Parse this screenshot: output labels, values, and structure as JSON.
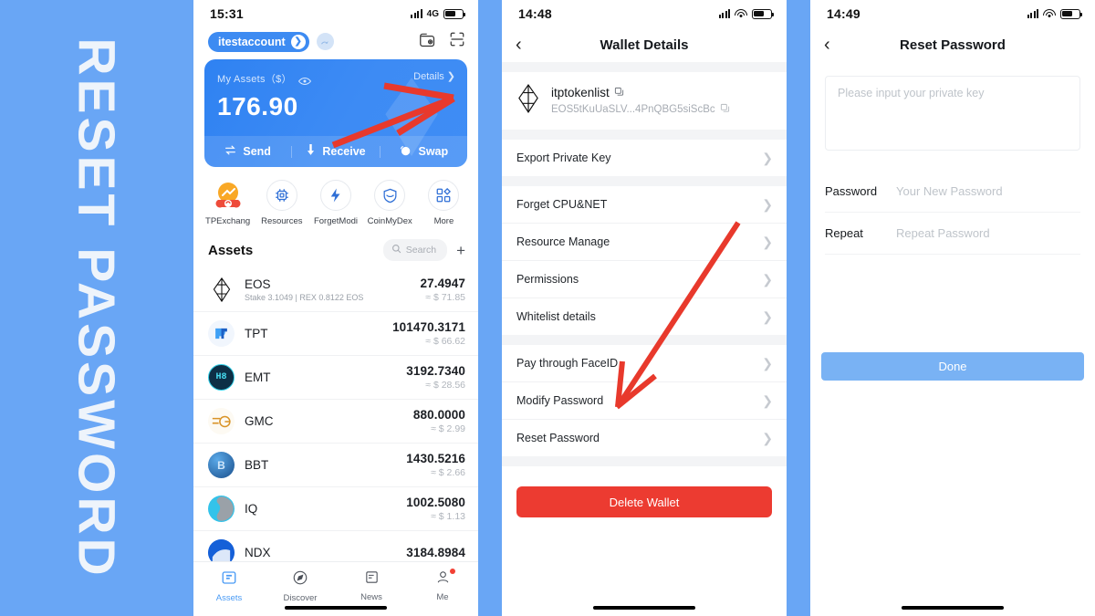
{
  "banner": {
    "text": "RESET PASSWORD",
    "bg_color": "#69a6f5",
    "text_color": "#eef4fb"
  },
  "phone1": {
    "status": {
      "time": "15:31",
      "network": "4G",
      "signal_icon": "signal-bars-icon",
      "battery_icon": "battery-icon"
    },
    "header": {
      "account_name": "itestaccount",
      "account_arrow_icon": "chevron-right-circle-icon",
      "avatar_icon": "avatar-icon",
      "wallet_icon": "wallet-camera-icon",
      "scan_icon": "qr-scan-icon"
    },
    "balance_card": {
      "label": "My Assets（$）",
      "eye_icon": "eye-icon",
      "details_label": "Details",
      "details_chevron": "chevron-right-icon",
      "amount": "176.90",
      "actions": [
        {
          "label": "Send",
          "icon": "send-swap-arrows-icon"
        },
        {
          "label": "Receive",
          "icon": "arrow-down-icon"
        },
        {
          "label": "Swap",
          "icon": "swap-circle-icon"
        }
      ]
    },
    "shortcuts": [
      {
        "label": "TPExchang",
        "icon": "tpexchange-icon"
      },
      {
        "label": "Resources",
        "icon": "cpu-chip-icon"
      },
      {
        "label": "ForgetModi",
        "icon": "lightning-bolt-icon"
      },
      {
        "label": "CoinMyDex",
        "icon": "shield-icon"
      },
      {
        "label": "More",
        "icon": "grid-more-icon"
      }
    ],
    "assets": {
      "title": "Assets",
      "search_placeholder": "Search",
      "search_icon": "search-icon",
      "add_icon": "plus-icon",
      "rows": [
        {
          "symbol": "EOS",
          "sub": "Stake 3.1049  |  REX 0.8122 EOS",
          "amount": "27.4947",
          "usd": "≈ $ 71.85",
          "icon": "eos-token-icon"
        },
        {
          "symbol": "TPT",
          "sub": "",
          "amount": "101470.3171",
          "usd": "≈ $ 66.62",
          "icon": "tpt-token-icon"
        },
        {
          "symbol": "EMT",
          "sub": "",
          "amount": "3192.7340",
          "usd": "≈ $ 28.56",
          "icon": "emt-token-icon"
        },
        {
          "symbol": "GMC",
          "sub": "",
          "amount": "880.0000",
          "usd": "≈ $ 2.99",
          "icon": "gmc-token-icon"
        },
        {
          "symbol": "BBT",
          "sub": "",
          "amount": "1430.5216",
          "usd": "≈ $ 2.66",
          "icon": "bbt-token-icon"
        },
        {
          "symbol": "IQ",
          "sub": "",
          "amount": "1002.5080",
          "usd": "≈ $ 1.13",
          "icon": "iq-token-icon"
        },
        {
          "symbol": "NDX",
          "sub": "",
          "amount": "3184.8984",
          "usd": "",
          "icon": "ndx-token-icon"
        }
      ]
    },
    "tabs": [
      {
        "label": "Assets",
        "icon": "assets-icon",
        "active": true,
        "badge": false
      },
      {
        "label": "Discover",
        "icon": "compass-icon",
        "active": false,
        "badge": false
      },
      {
        "label": "News",
        "icon": "news-icon",
        "active": false,
        "badge": false
      },
      {
        "label": "Me",
        "icon": "person-icon",
        "active": false,
        "badge": true
      }
    ]
  },
  "phone2": {
    "status": {
      "time": "14:48",
      "signal_icon": "signal-bars-icon",
      "wifi_icon": "wifi-icon",
      "battery_icon": "battery-icon"
    },
    "nav": {
      "back_icon": "chevron-left-icon",
      "title": "Wallet Details"
    },
    "wallet": {
      "icon": "eos-token-icon",
      "name": "itptokenlist",
      "name_copy_icon": "copy-icon",
      "address": "EOS5tKuUaSLV...4PnQBG5siScBc",
      "address_copy_icon": "copy-icon"
    },
    "groups": [
      [
        {
          "label": "Export Private Key",
          "chevron": "chevron-right-icon"
        }
      ],
      [
        {
          "label": "Forget CPU&NET",
          "chevron": "chevron-right-icon"
        },
        {
          "label": "Resource Manage",
          "chevron": "chevron-right-icon"
        },
        {
          "label": "Permissions",
          "chevron": "chevron-right-icon"
        },
        {
          "label": "Whitelist details",
          "chevron": "chevron-right-icon"
        }
      ],
      [
        {
          "label": "Pay through FaceID",
          "chevron": "chevron-right-icon"
        },
        {
          "label": "Modify Password",
          "chevron": "chevron-right-icon"
        },
        {
          "label": "Reset Password",
          "chevron": "chevron-right-icon"
        }
      ]
    ],
    "delete_button": {
      "label": "Delete Wallet",
      "color": "#ec3b31"
    }
  },
  "phone3": {
    "status": {
      "time": "14:49",
      "signal_icon": "signal-bars-icon",
      "wifi_icon": "wifi-icon",
      "battery_icon": "battery-icon"
    },
    "nav": {
      "back_icon": "chevron-left-icon",
      "title": "Reset Password"
    },
    "private_key_placeholder": "Please input your private key",
    "fields": [
      {
        "label": "Password",
        "placeholder": "Your New Password",
        "value": ""
      },
      {
        "label": "Repeat",
        "placeholder": "Repeat Password",
        "value": ""
      }
    ],
    "done_button": {
      "label": "Done",
      "color": "#79b2f4"
    }
  },
  "annotations": {
    "arrow_color": "#e8392c",
    "count": 2
  }
}
